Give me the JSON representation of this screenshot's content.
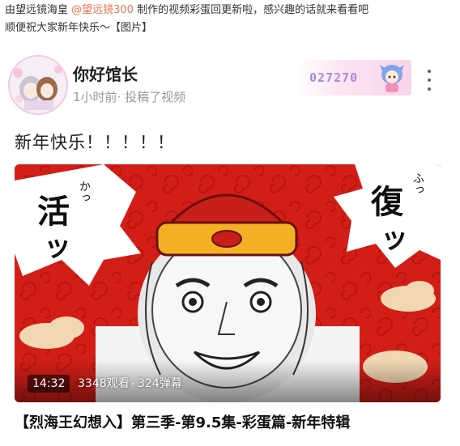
{
  "post": {
    "line1_prefix": "由望远镜海皇 ",
    "mention": "@望远镜300",
    "line1_suffix": " 制作的视频彩蛋回更新啦，感兴趣的话就来看看吧",
    "line2": "顺便祝大家新年快乐～【图片】"
  },
  "card": {
    "author_name": "你好馆长",
    "meta": "1小时前· 投稿了视频",
    "badge_number": "027270",
    "title": "新年快乐！！！！！",
    "video": {
      "duration": "14:32",
      "views": "3348观看",
      "separator": "·",
      "danmaku": "324弹幕",
      "left_caption": "活",
      "left_ruby": "かっ",
      "left_tsu": "ッ",
      "right_caption": "復",
      "right_ruby": "ふっ",
      "right_tsu": "ッ"
    },
    "video_title": "【烈海王幻想入】第三季-第9.5集-彩蛋篇-新年特辑"
  },
  "colors": {
    "mention": "#eb7350",
    "video_red": "#d31e18",
    "badge_text": "#a88ad8"
  },
  "icons": [
    "more-vertical-icon"
  ]
}
